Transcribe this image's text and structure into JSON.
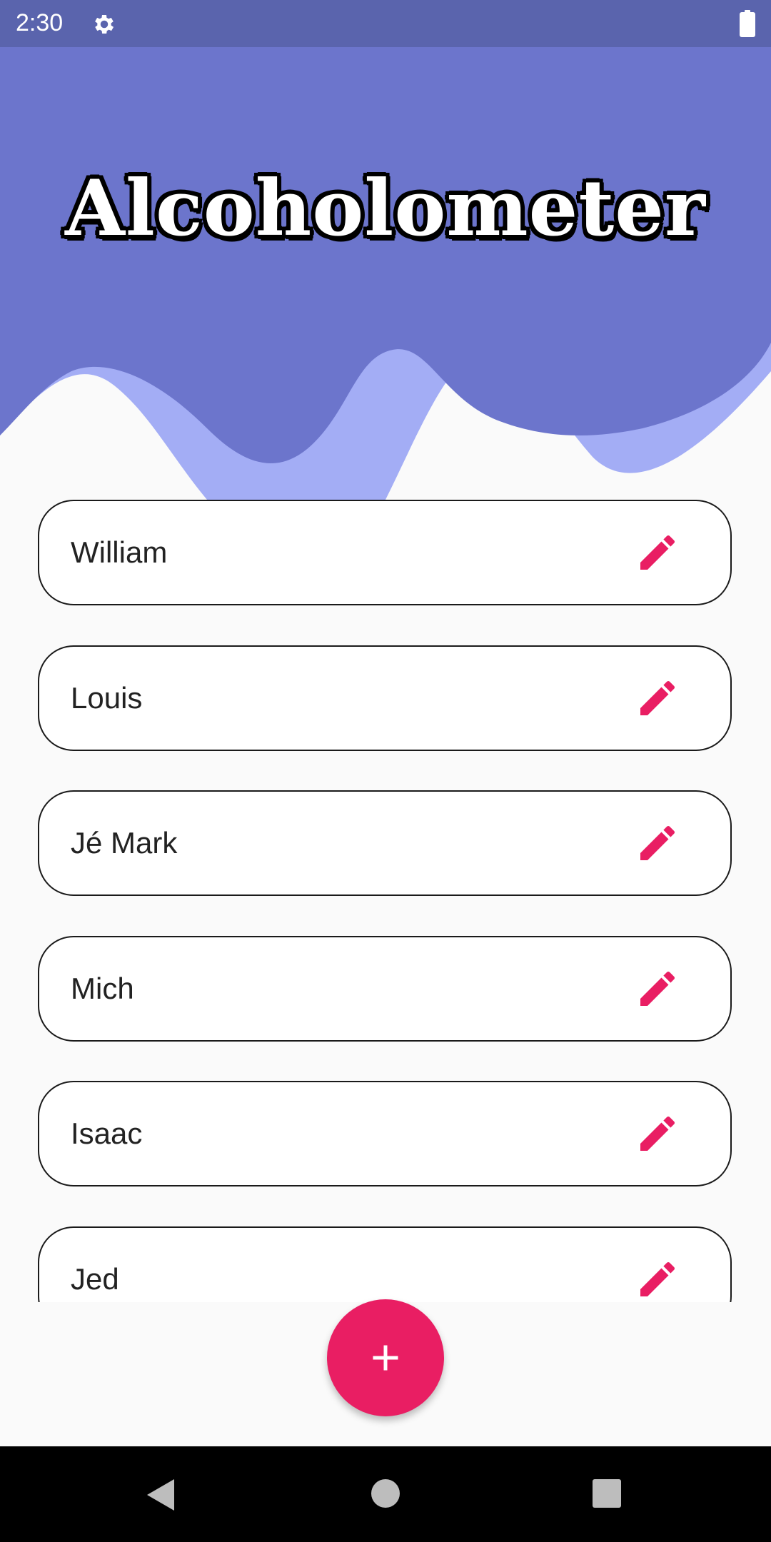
{
  "status_bar": {
    "time": "2:30",
    "icons": [
      "gear-icon",
      "battery-icon"
    ]
  },
  "header": {
    "title": "Alcoholometer"
  },
  "people": [
    {
      "name": "William"
    },
    {
      "name": "Louis"
    },
    {
      "name": "Jé Mark"
    },
    {
      "name": "Mich"
    },
    {
      "name": "Isaac"
    },
    {
      "name": "Jed"
    }
  ],
  "fab": {
    "icon": "plus-icon"
  },
  "nav_bar": {
    "icons": [
      "back-icon",
      "home-icon",
      "recents-icon"
    ]
  },
  "colors": {
    "header": "#6c75cc",
    "wave_light": "#a3adf5",
    "status_bar": "#5a64ad",
    "accent": "#e91e63"
  }
}
